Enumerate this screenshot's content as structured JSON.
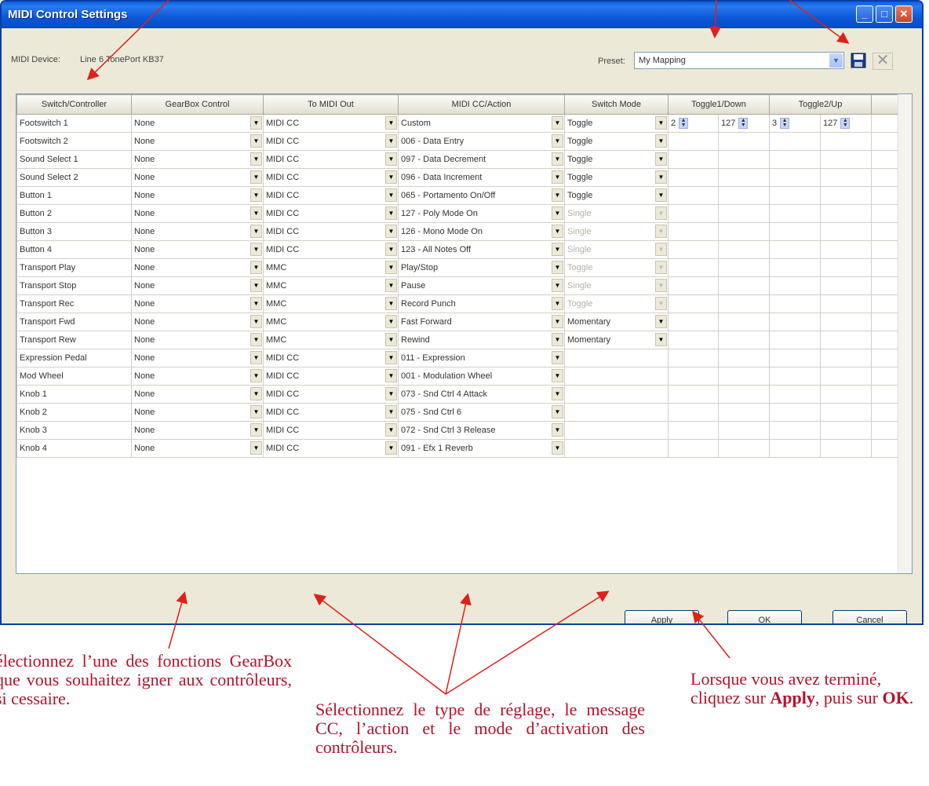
{
  "window": {
    "title": "MIDI Control Settings"
  },
  "device": {
    "label": "MIDI Device:",
    "value": "Line 6 TonePort KB37"
  },
  "preset": {
    "label": "Preset:",
    "value": "My Mapping"
  },
  "icons": {
    "save": "save-icon",
    "delete": "delete-icon"
  },
  "columns": [
    "Switch/Controller",
    "GearBox Control",
    "To MIDI Out",
    "MIDI CC/Action",
    "Switch Mode",
    "Toggle1/Down",
    "Toggle2/Up"
  ],
  "rows": [
    {
      "ctrl": "Footswitch 1",
      "gear": "None",
      "out": "MIDI CC",
      "cc": "Custom",
      "mode": "Toggle",
      "modeState": "on",
      "t1a": "2",
      "t1b": "127",
      "t2a": "3",
      "t2b": "127"
    },
    {
      "ctrl": "Footswitch 2",
      "gear": "None",
      "out": "MIDI CC",
      "cc": "006 - Data Entry",
      "mode": "Toggle",
      "modeState": "on"
    },
    {
      "ctrl": "Sound Select 1",
      "gear": "None",
      "out": "MIDI CC",
      "cc": "097 - Data Decrement",
      "mode": "Toggle",
      "modeState": "on"
    },
    {
      "ctrl": "Sound Select 2",
      "gear": "None",
      "out": "MIDI CC",
      "cc": "096 - Data Increment",
      "mode": "Toggle",
      "modeState": "on"
    },
    {
      "ctrl": "Button 1",
      "gear": "None",
      "out": "MIDI CC",
      "cc": "065 - Portamento On/Off",
      "mode": "Toggle",
      "modeState": "on"
    },
    {
      "ctrl": "Button 2",
      "gear": "None",
      "out": "MIDI CC",
      "cc": "127 - Poly Mode On",
      "mode": "Single",
      "modeState": "dis"
    },
    {
      "ctrl": "Button 3",
      "gear": "None",
      "out": "MIDI CC",
      "cc": "126 - Mono Mode On",
      "mode": "Single",
      "modeState": "dis"
    },
    {
      "ctrl": "Button 4",
      "gear": "None",
      "out": "MIDI CC",
      "cc": "123 - All Notes Off",
      "mode": "Single",
      "modeState": "dis"
    },
    {
      "ctrl": "Transport Play",
      "gear": "None",
      "out": "MMC",
      "cc": "Play/Stop",
      "mode": "Toggle",
      "modeState": "dis"
    },
    {
      "ctrl": "Transport Stop",
      "gear": "None",
      "out": "MMC",
      "cc": "Pause",
      "mode": "Single",
      "modeState": "dis"
    },
    {
      "ctrl": "Transport Rec",
      "gear": "None",
      "out": "MMC",
      "cc": "Record Punch",
      "mode": "Toggle",
      "modeState": "dis"
    },
    {
      "ctrl": "Transport Fwd",
      "gear": "None",
      "out": "MMC",
      "cc": "Fast Forward",
      "mode": "Momentary",
      "modeState": "on"
    },
    {
      "ctrl": "Transport Rew",
      "gear": "None",
      "out": "MMC",
      "cc": "Rewind",
      "mode": "Momentary",
      "modeState": "on"
    },
    {
      "ctrl": "Expression Pedal",
      "gear": "None",
      "out": "MIDI CC",
      "cc": "011 - Expression",
      "mode": "",
      "modeState": "none"
    },
    {
      "ctrl": "Mod Wheel",
      "gear": "None",
      "out": "MIDI CC",
      "cc": "001 - Modulation Wheel",
      "mode": "",
      "modeState": "none"
    },
    {
      "ctrl": "Knob 1",
      "gear": "None",
      "out": "MIDI CC",
      "cc": "073 - Snd Ctrl 4 Attack",
      "mode": "",
      "modeState": "none"
    },
    {
      "ctrl": "Knob 2",
      "gear": "None",
      "out": "MIDI CC",
      "cc": "075 - Snd Ctrl 6",
      "mode": "",
      "modeState": "none"
    },
    {
      "ctrl": "Knob 3",
      "gear": "None",
      "out": "MIDI CC",
      "cc": "072 - Snd Ctrl 3 Release",
      "mode": "",
      "modeState": "none"
    },
    {
      "ctrl": "Knob 4",
      "gear": "None",
      "out": "MIDI CC",
      "cc": "091 - Efx 1 Reverb",
      "mode": "",
      "modeState": "none"
    }
  ],
  "buttons": {
    "apply": "Apply",
    "ok": "OK",
    "cancel": "Cancel"
  },
  "annotations": {
    "left": "électionnez l’une des fonctions GearBox que vous souhaitez igner aux contrôleurs, si cessaire.",
    "middle": "Sélectionnez le type de réglage, le message CC, l’action et le mode d’activation des contrôleurs.",
    "right_a": "Lorsque vous avez terminé, cliquez sur ",
    "right_apply": "Apply",
    "right_b": ", puis sur ",
    "right_ok": "OK",
    "right_c": "."
  },
  "colors": {
    "annotation": "#b4122d",
    "arrow": "#e0201a",
    "titlebar": "#0a5fe0"
  }
}
